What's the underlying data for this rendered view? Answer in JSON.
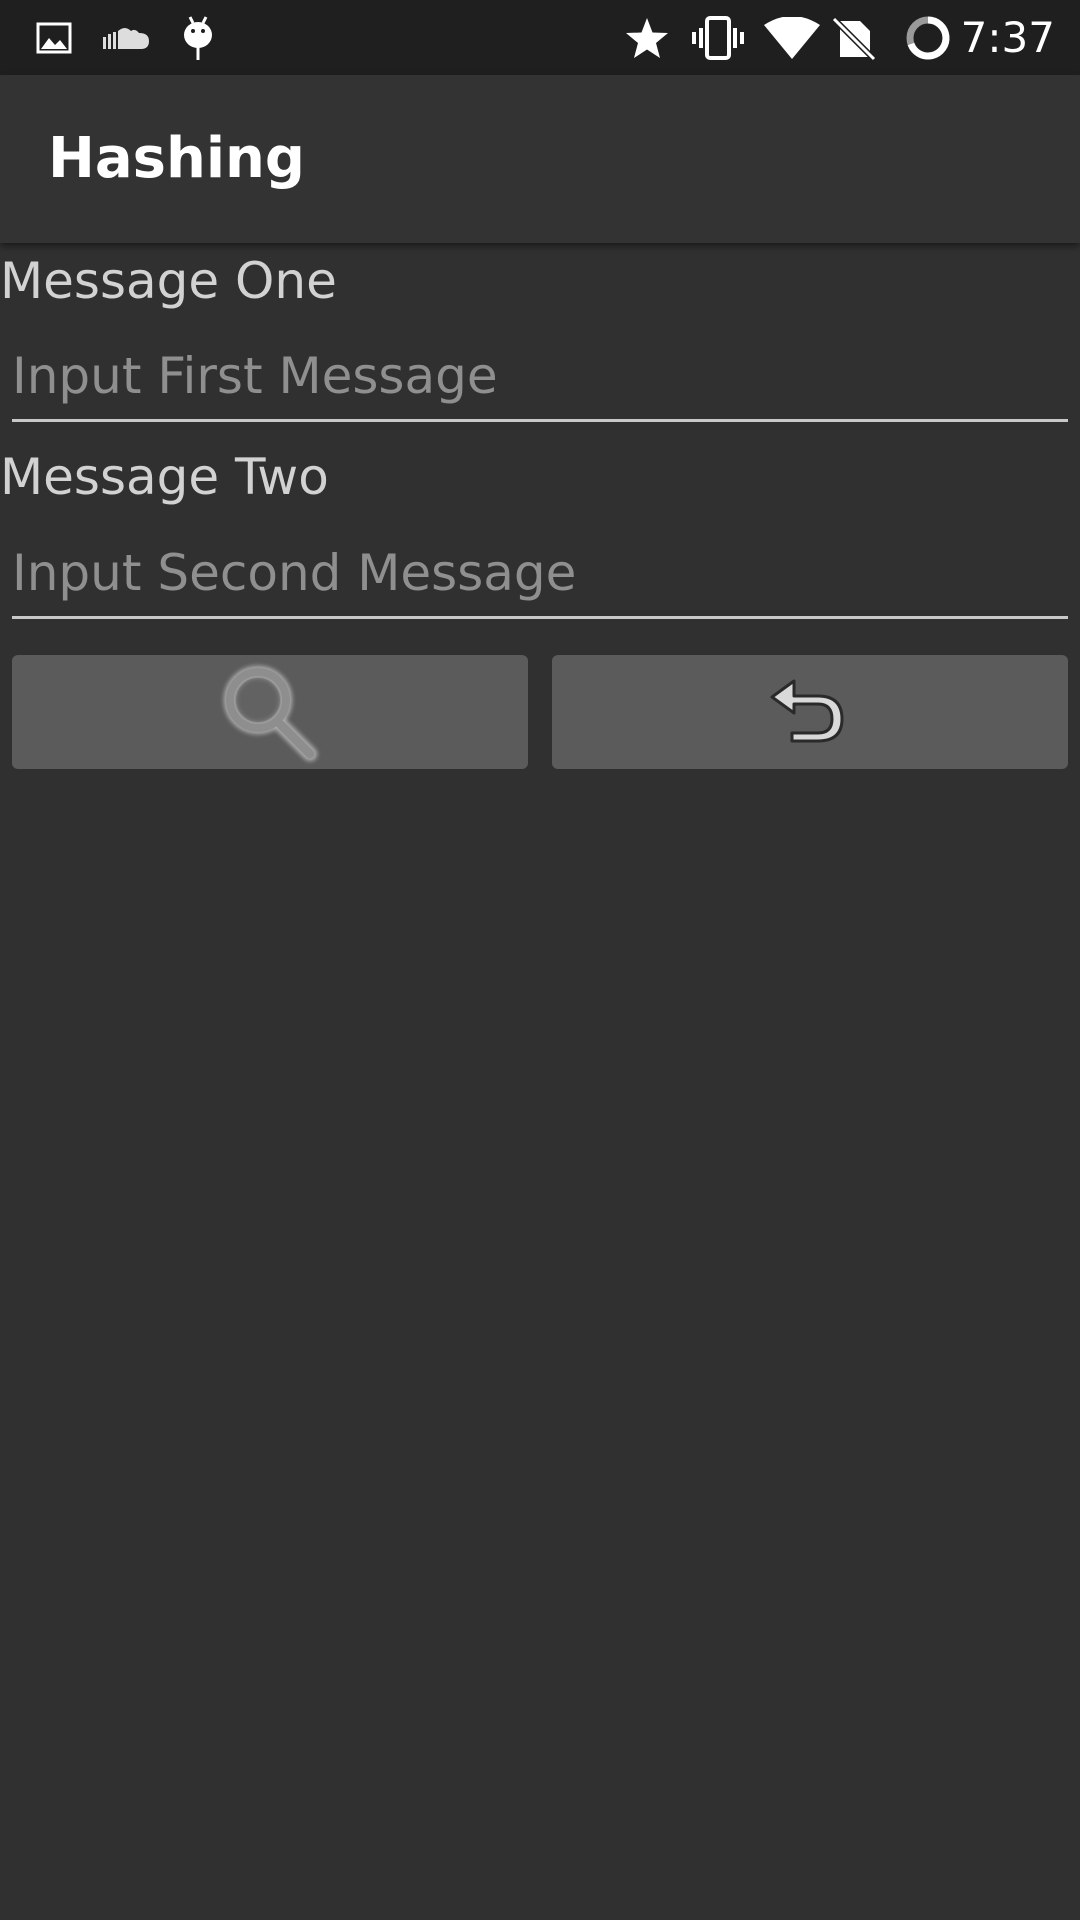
{
  "status_bar": {
    "time": "7:37",
    "left_icons": [
      "image-icon",
      "cloud-icon",
      "android-debug-icon"
    ],
    "right_icons": [
      "star-icon",
      "vibrate-icon",
      "wifi-icon",
      "no-sim-icon",
      "battery-ring-icon"
    ]
  },
  "app_bar": {
    "title": "Hashing"
  },
  "form": {
    "message_one": {
      "label": "Message One",
      "value": "",
      "placeholder": "Input First Message"
    },
    "message_two": {
      "label": "Message Two",
      "value": "",
      "placeholder": "Input Second Message"
    }
  },
  "buttons": {
    "search_icon": "search-icon",
    "undo_icon": "undo-icon"
  },
  "colors": {
    "background": "#303030",
    "status_bar": "#1f1f1f",
    "app_bar": "#333333",
    "button": "#5b5b5c",
    "label_text": "#d2d2d2",
    "placeholder_text": "#8f8f8f"
  }
}
